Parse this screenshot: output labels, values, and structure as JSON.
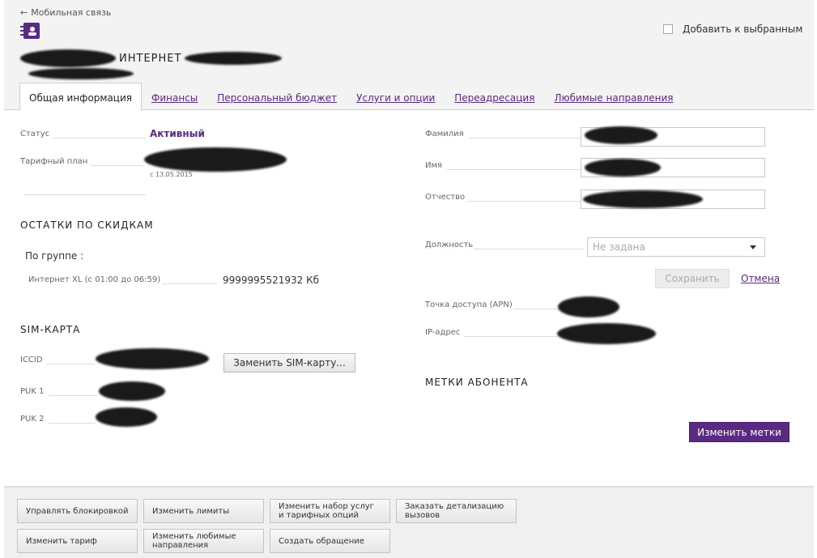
{
  "header": {
    "back_label": "Мобильная связь",
    "title": "ИНТЕРНЕТ",
    "favorite_label": "Добавить к выбранным"
  },
  "tabs": [
    {
      "label": "Общая информация",
      "active": true
    },
    {
      "label": "Финансы"
    },
    {
      "label": "Персональный бюджет"
    },
    {
      "label": "Услуги и опции"
    },
    {
      "label": "Переадресация"
    },
    {
      "label": "Любимые направления"
    }
  ],
  "left": {
    "status_label": "Статус",
    "status_value": "Активный",
    "tariff_label": "Тарифный план",
    "tariff_since": "с 13.05.2015",
    "discounts_title": "ОСТАТКИ ПО СКИДКАМ",
    "group_label": "По группе :",
    "discount_item_label": "Интернет XL (с 01:00 до 06:59)",
    "discount_item_value": "9999995521932 Кб",
    "sim_title": "SIM-КАРТА",
    "iccid_label": "ICCID",
    "replace_sim_button": "Заменить SIM-карту...",
    "puk1_label": "PUK 1",
    "puk2_label": "PUK 2"
  },
  "right": {
    "surname_label": "Фамилия",
    "name_label": "Имя",
    "patronymic_label": "Отчество",
    "position_label": "Должность",
    "position_value": "Не задана",
    "save_button": "Сохранить",
    "cancel_link": "Отмена",
    "apn_label": "Точка доступа (APN)",
    "ip_label": "IP-адрес",
    "tags_title": "МЕТКИ АБОНЕНТА",
    "edit_tags_button": "Изменить метки"
  },
  "footer": {
    "buttons": [
      "Управлять блокировкой",
      "Изменить лимиты",
      "Изменить набор услуг и тарифных опций",
      "Заказать детализацию вызовов",
      "Изменить тариф",
      "Изменить любимые направления",
      "Создать обращение"
    ]
  },
  "colors": {
    "accent": "#5a2a82",
    "header_bg": "#f3f3f3"
  }
}
